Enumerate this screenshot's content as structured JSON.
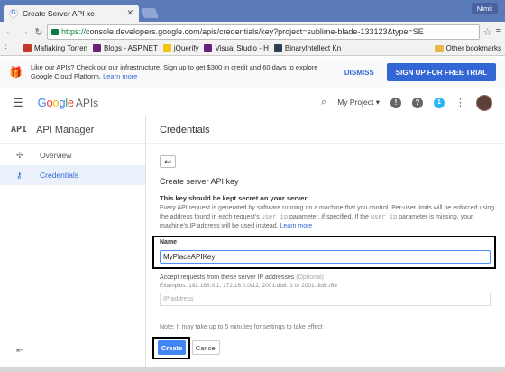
{
  "browser": {
    "tab_title": "Create Server API ke",
    "profile": "Nimit",
    "url_https": "https://",
    "url_rest": "console.developers.google.com/apis/credentials/key?project=sublime-blade-133123&type=SE",
    "bookmarks": [
      {
        "label": "Mafiaking Torren",
        "color": "#c0392b"
      },
      {
        "label": "Blogs - ASP.NET",
        "color": "#6d2077"
      },
      {
        "label": "jQuerify",
        "color": "#f1c40f"
      },
      {
        "label": "Visual Studio - H",
        "color": "#68217a"
      },
      {
        "label": "BinaryIntellect Kn",
        "color": "#2c3e50"
      }
    ],
    "other_bookmarks": "Other bookmarks"
  },
  "promo": {
    "text": "Like our APIs? Check out our infrastructure. Sign up to get $300 in credit and 60 days to explore Google Cloud Platform.",
    "learn_more": "Learn more",
    "dismiss": "DISMISS",
    "signup": "SIGN UP FOR FREE TRIAL"
  },
  "header": {
    "logo_google": "Google",
    "logo_apis": "APIs",
    "project": "My Project",
    "notification_count": "1"
  },
  "sidebar": {
    "api_badge": "API",
    "title": "API Manager",
    "items": [
      {
        "label": "Overview"
      },
      {
        "label": "Credentials"
      }
    ]
  },
  "main": {
    "page_title": "Credentials",
    "section_title": "Create server API key",
    "secret_title": "This key should be kept secret on your server",
    "secret_desc_1": "Every API request is generated by software running on a machine that you control. Per-user limits will be enforced using the address found in each request's",
    "secret_code_1": "user_ip",
    "secret_desc_2": "parameter, if specified. If the",
    "secret_code_2": "user_ip",
    "secret_desc_3": "parameter is missing, your machine's IP address will be used instead.",
    "learn_more": "Learn more",
    "name_label": "Name",
    "name_value": "MyPlaceAPIKey",
    "accept_label": "Accept requests from these server IP addresses",
    "accept_optional": "(Optional)",
    "examples": "Examples: 192.168.0.1, 172.16.0.0/12, 2001:db8::1 or 2001:db8::/64",
    "ip_placeholder": "IP address",
    "note": "Note: It may take up to 5 minutes for settings to take effect",
    "create": "Create",
    "cancel": "Cancel"
  }
}
